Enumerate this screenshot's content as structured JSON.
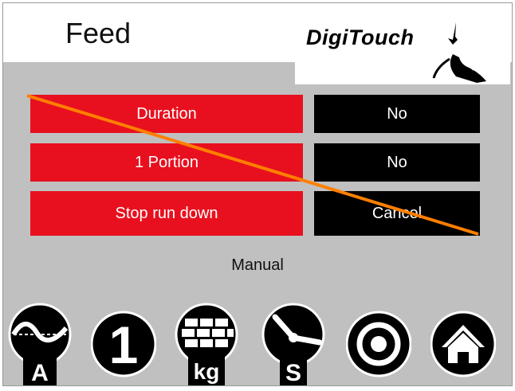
{
  "header": {
    "title": "Feed",
    "logo_text": "DigiTouch"
  },
  "rows": [
    {
      "label": "Duration",
      "value": "No"
    },
    {
      "label": "1 Portion",
      "value": "No"
    },
    {
      "label": "Stop run down",
      "value": "Cancel"
    }
  ],
  "status_label": "Manual",
  "icons": [
    {
      "name": "sine-wave-a-icon",
      "label": "A"
    },
    {
      "name": "one-icon",
      "label": "1"
    },
    {
      "name": "bricks-kg-icon",
      "label": "kg"
    },
    {
      "name": "clock-s-icon",
      "label": "S"
    },
    {
      "name": "target-icon"
    },
    {
      "name": "home-icon"
    }
  ],
  "colors": {
    "accent_red": "#e8101e",
    "value_black": "#000000",
    "panel_gray": "#c0c0c0",
    "strike_orange": "#ff7f00"
  }
}
